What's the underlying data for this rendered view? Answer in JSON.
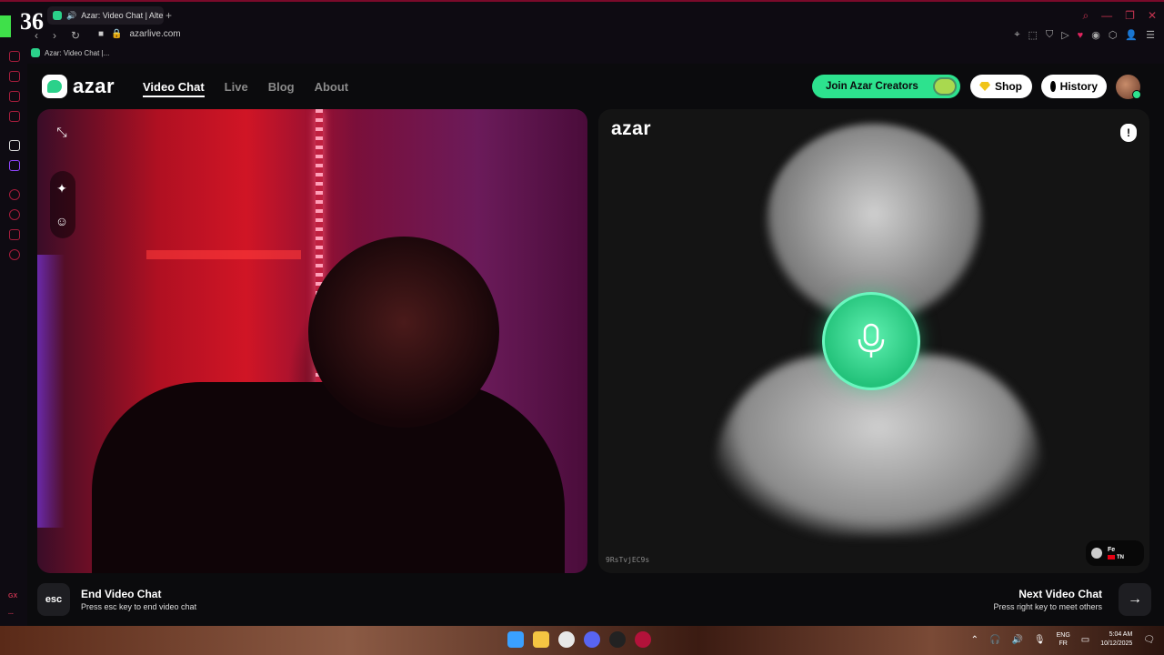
{
  "browser": {
    "tab_title": "Azar: Video Chat | Alte",
    "new_tab": "+",
    "url": "azarlive.com",
    "bookmark": "Azar: Video Chat |...",
    "overlay_number": "36"
  },
  "sidebar": {
    "gx_label": "GX",
    "more_label": "..."
  },
  "site": {
    "logo": "azar",
    "nav": [
      "Video Chat",
      "Live",
      "Blog",
      "About"
    ],
    "join_button": "Join Azar Creators",
    "shop_button": "Shop",
    "history_button": "History"
  },
  "remote": {
    "logo": "azar",
    "report_icon": "!",
    "id": "9RsTvjEC9s",
    "peer_name": "Fe",
    "peer_country": "TN"
  },
  "footer": {
    "esc_key": "esc",
    "end_label": "End Video Chat",
    "end_hint": "Press esc key to end video chat",
    "next_label": "Next Video Chat",
    "next_hint": "Press right key to meet others",
    "next_arrow": "→"
  },
  "taskbar": {
    "lang_top": "ENG",
    "lang_bottom": "FR",
    "time": "5:04 AM",
    "date": "10/12/2025"
  },
  "colors": {
    "accent": "#2de28e",
    "opera_red": "#c2334f"
  }
}
